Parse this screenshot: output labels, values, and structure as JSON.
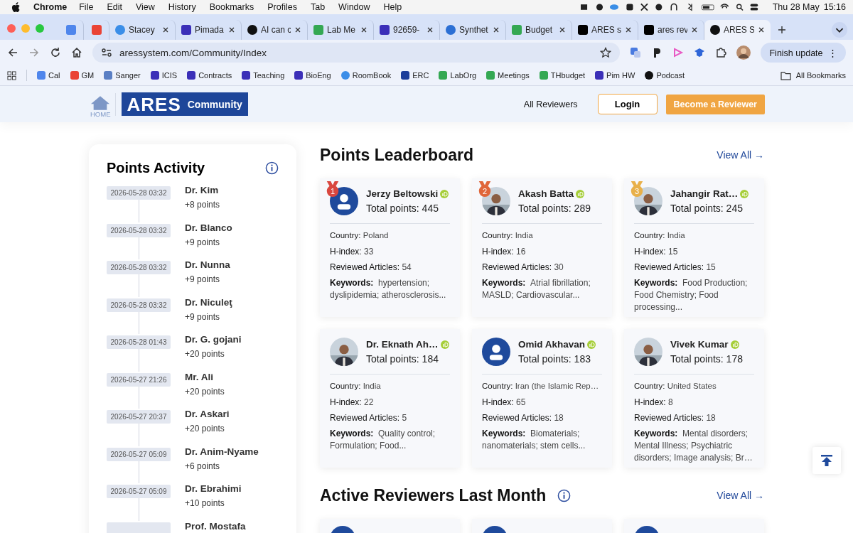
{
  "menubar": {
    "app": "Chrome",
    "menus": [
      "File",
      "Edit",
      "View",
      "History",
      "Bookmarks",
      "Profiles",
      "Tab",
      "Window",
      "Help"
    ],
    "date": "Thu 28 May",
    "time": "15:16"
  },
  "tabs": [
    {
      "kind": "calendar",
      "selected": false
    },
    {
      "kind": "mail",
      "selected": false
    },
    {
      "title": "Stacey",
      "kind": "cloud",
      "selected": false
    },
    {
      "title": "Pimada",
      "kind": "letter",
      "selected": false
    },
    {
      "title": "AI can c",
      "kind": "round",
      "selected": false
    },
    {
      "title": "Lab Me",
      "kind": "sheet",
      "selected": false
    },
    {
      "title": "92659-",
      "kind": "letter",
      "selected": false
    },
    {
      "title": "Synthet",
      "kind": "link",
      "selected": false
    },
    {
      "title": "Budget",
      "kind": "sheet",
      "selected": false
    },
    {
      "title": "ARES s",
      "kind": "x",
      "selected": false
    },
    {
      "title": "ares rev",
      "kind": "x",
      "selected": false
    },
    {
      "title": "ARES S",
      "kind": "round",
      "selected": true
    }
  ],
  "address": {
    "url": "aressystem.com/Community/Index",
    "update_button": "Finish update",
    "menu_glyph": "⋮"
  },
  "bookmarks": [
    {
      "label": "Cal",
      "kind": "calendar"
    },
    {
      "label": "GM",
      "kind": "mail"
    },
    {
      "label": "Sanger",
      "kind": "grid"
    },
    {
      "label": "ICIS",
      "kind": "letter"
    },
    {
      "label": "Contracts",
      "kind": "letter"
    },
    {
      "label": "Teaching",
      "kind": "letter"
    },
    {
      "label": "BioEng",
      "kind": "letter"
    },
    {
      "label": "RoomBook",
      "kind": "cloud"
    },
    {
      "label": "ERC",
      "kind": "flag"
    },
    {
      "label": "LabOrg",
      "kind": "sheet"
    },
    {
      "label": "Meetings",
      "kind": "sheet"
    },
    {
      "label": "THbudget",
      "kind": "sheet"
    },
    {
      "label": "Pim HW",
      "kind": "letter"
    },
    {
      "label": "Podcast",
      "kind": "round"
    }
  ],
  "all_bookmarks": "All Bookmarks",
  "site_header": {
    "home": "HOME",
    "logo": "ARES",
    "logo_suffix": "Community",
    "nav_link": "All Reviewers",
    "login": "Login",
    "cta": "Become a Reviewer"
  },
  "points_activity": {
    "title": "Points Activity",
    "items": [
      {
        "date": "2026-05-28 03:32",
        "name": "Dr. Kim",
        "points": "+8 points"
      },
      {
        "date": "2026-05-28 03:32",
        "name": "Dr. Blanco",
        "points": "+9 points"
      },
      {
        "date": "2026-05-28 03:32",
        "name": "Dr. Nunna",
        "points": "+9 points"
      },
      {
        "date": "2026-05-28 03:32",
        "name": "Dr. Niculeţ",
        "points": "+9 points"
      },
      {
        "date": "2026-05-28 01:43",
        "name": "Dr. G. gojani",
        "points": "+20 points"
      },
      {
        "date": "2026-05-27 21:26",
        "name": "Mr. Ali",
        "points": "+20 points"
      },
      {
        "date": "2026-05-27 20:37",
        "name": "Dr. Askari",
        "points": "+20 points"
      },
      {
        "date": "2026-05-27 05:09",
        "name": "Dr. Anim-Nyame",
        "points": "+6 points"
      },
      {
        "date": "2026-05-27 05:09",
        "name": "Dr. Ebrahimi",
        "points": "+10 points"
      },
      {
        "name": "Prof. Mostafa"
      }
    ]
  },
  "leaderboard": {
    "title": "Points Leaderboard",
    "view_all": "View All",
    "view_all_arrow": "→",
    "cards": [
      {
        "rank": "1",
        "color": "#d9473f",
        "has_photo": false,
        "name": "Jerzy Beltowski",
        "total": "Total points: 445",
        "country_label": "Country:",
        "country": "Poland",
        "h_index_label": "H-index:",
        "h_index": "33",
        "reviewed_label": "Reviewed Articles:",
        "reviewed": "54",
        "keywords_label": "Keywords:",
        "keywords": "hypertension; dyslipidemia; atherosclerosis..."
      },
      {
        "rank": "2",
        "color": "#e0663a",
        "has_photo": true,
        "name": "Akash Batta",
        "total": "Total points: 289",
        "country_label": "Country:",
        "country": "India",
        "h_index_label": "H-index:",
        "h_index": "16",
        "reviewed_label": "Reviewed Articles:",
        "reviewed": "30",
        "keywords_label": "Keywords:",
        "keywords": "Atrial fibrillation; MASLD; Cardiovascular..."
      },
      {
        "rank": "3",
        "color": "#e8b04a",
        "has_photo": true,
        "name": "Jahangir Rat…",
        "total": "Total points: 245",
        "country_label": "Country:",
        "country": "India",
        "h_index_label": "H-index:",
        "h_index": "15",
        "reviewed_label": "Reviewed Articles:",
        "reviewed": "15",
        "keywords_label": "Keywords:",
        "keywords": "Food Production; Food Chemistry; Food processing..."
      },
      {
        "has_photo": true,
        "name": "Dr. Eknath Ah…",
        "total": "Total points: 184",
        "country_label": "Country:",
        "country": "India",
        "h_index_label": "H-index:",
        "h_index": "22",
        "reviewed_label": "Reviewed Articles:",
        "reviewed": "5",
        "keywords_label": "Keywords:",
        "keywords": "Quality control; Formulation; Food..."
      },
      {
        "has_photo": false,
        "name": "Omid Akhavan",
        "total": "Total points: 183",
        "country_label": "Country:",
        "country": "Iran (the Islamic Rep…",
        "h_index_label": "H-index:",
        "h_index": "65",
        "reviewed_label": "Reviewed Articles:",
        "reviewed": "18",
        "keywords_label": "Keywords:",
        "keywords": "Biomaterials; nanomaterials; stem cells..."
      },
      {
        "has_photo": true,
        "name": "Vivek Kumar",
        "total": "Total points: 178",
        "country_label": "Country:",
        "country": "United States",
        "h_index_label": "H-index:",
        "h_index": "8",
        "reviewed_label": "Reviewed Articles:",
        "reviewed": "18",
        "keywords_label": "Keywords:",
        "keywords": "Mental disorders; Mental Illness; Psychiatric disorders; Image analysis; Br…"
      }
    ]
  },
  "active": {
    "title": "Active Reviewers Last Month",
    "view_all": "View All",
    "view_all_arrow": "→",
    "cards": [
      {
        "has_photo": false
      },
      {
        "has_photo": false
      },
      {
        "has_photo": false
      }
    ]
  }
}
